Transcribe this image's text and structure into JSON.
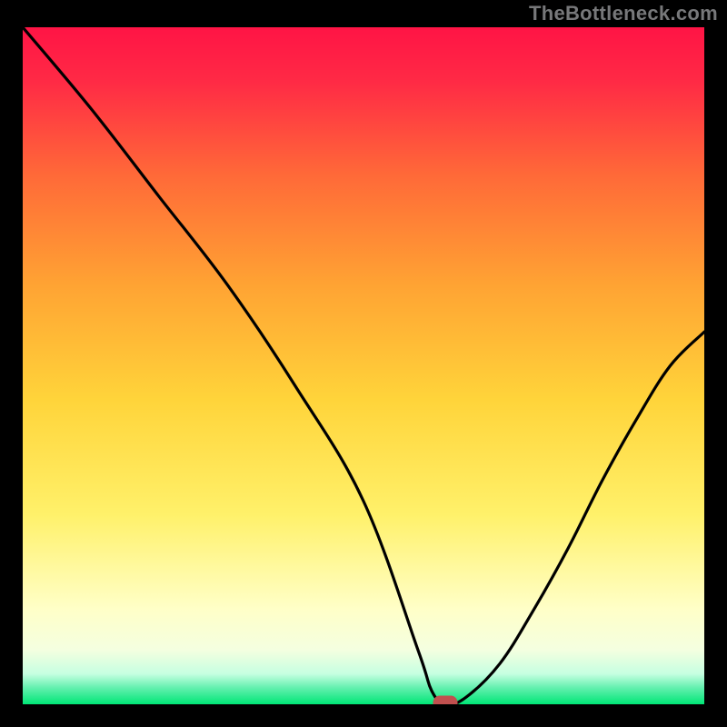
{
  "watermark": "TheBottleneck.com",
  "chart_data": {
    "type": "line",
    "title": "",
    "xlabel": "",
    "ylabel": "",
    "xlim": [
      0,
      100
    ],
    "ylim": [
      0,
      100
    ],
    "grid": false,
    "legend": false,
    "series": [
      {
        "name": "curve",
        "x": [
          0,
          10,
          20,
          30,
          40,
          50,
          58,
          60,
          62,
          65,
          70,
          75,
          80,
          85,
          90,
          95,
          100
        ],
        "values": [
          100,
          88,
          75,
          62,
          47,
          30,
          8,
          2,
          0,
          1,
          6,
          14,
          23,
          33,
          42,
          50,
          55
        ]
      }
    ],
    "optimum_marker": {
      "x": 62,
      "y": 0
    },
    "gradient_colors": {
      "top": "#ff1445",
      "mid_upper": "#ff8a2b",
      "mid": "#ffd43a",
      "mid_lower": "#fff16a",
      "pale": "#ffffc8",
      "green": "#00e676"
    }
  }
}
